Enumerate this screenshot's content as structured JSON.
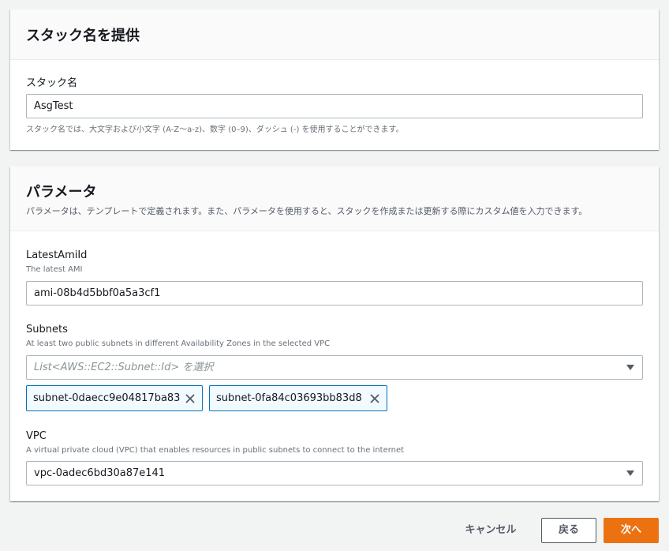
{
  "stack_panel": {
    "title": "スタック名を提供",
    "name_label": "スタック名",
    "name_value": "AsgTest",
    "name_hint": "スタック名では、大文字および小文字 (A-Z〜a-z)、数字 (0–9)、ダッシュ (-) を使用することができます。"
  },
  "params_panel": {
    "title": "パラメータ",
    "description": "パラメータは、テンプレートで定義されます。また、パラメータを使用すると、スタックを作成または更新する際にカスタム値を入力できます。",
    "ami": {
      "label": "LatestAmiId",
      "desc": "The latest AMI",
      "value": "ami-08b4d5bbf0a5a3cf1"
    },
    "subnets": {
      "label": "Subnets",
      "desc": "At least two public subnets in different Availability Zones in the selected VPC",
      "placeholder": "List<AWS::EC2::Subnet::Id> を選択",
      "tokens": [
        "subnet-0daecc9e04817ba83",
        "subnet-0fa84c03693bb83d8"
      ]
    },
    "vpc": {
      "label": "VPC",
      "desc": "A virtual private cloud (VPC) that enables resources in public subnets to connect to the internet",
      "value": "vpc-0adec6bd30a87e141"
    }
  },
  "footer": {
    "cancel_label": "キャンセル",
    "back_label": "戻る",
    "next_label": "次へ"
  },
  "colors": {
    "primary": "#ec7211",
    "token_border": "#0073bb",
    "token_bg": "#f1faff"
  },
  "icons": {
    "token_remove": "close-icon",
    "dropdown": "caret-down-icon"
  }
}
